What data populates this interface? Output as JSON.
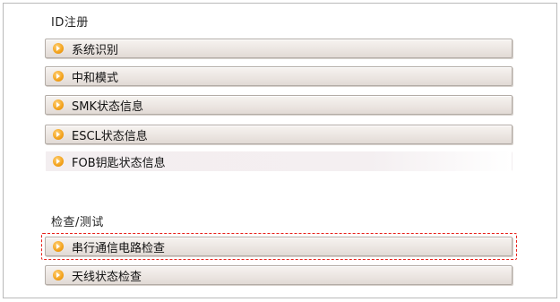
{
  "sections": {
    "id_register": {
      "title": "ID注册",
      "items": [
        {
          "label": "系统识别"
        },
        {
          "label": "中和模式"
        },
        {
          "label": "SMK状态信息"
        },
        {
          "label": "ESCL状态信息"
        },
        {
          "label": "FOB钥匙状态信息"
        }
      ]
    },
    "check_test": {
      "title": "检查/测试",
      "items": [
        {
          "label": "串行通信电路检查",
          "highlighted": true
        },
        {
          "label": "天线状态检查"
        }
      ]
    }
  },
  "colors": {
    "bullet": "#f3a21b",
    "highlight_border": "#e8201a",
    "button_bg": "#ece6e2"
  },
  "icons": {
    "bullet": "orange-arrow-circle-icon"
  }
}
